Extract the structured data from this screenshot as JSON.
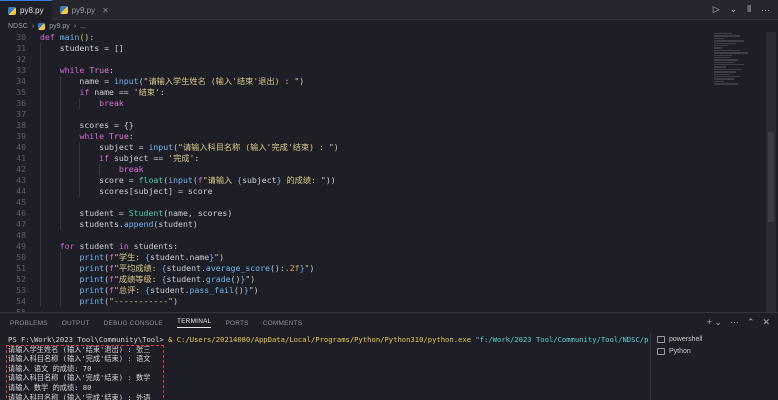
{
  "tabs": [
    {
      "label": "py8.py",
      "active": true,
      "closable": false
    },
    {
      "label": "py9.py",
      "active": false,
      "closable": true
    }
  ],
  "tabbar_actions": [
    "▷",
    "⌄",
    "⫴",
    "···"
  ],
  "breadcrumb": [
    "NDSC",
    "py9.py",
    "..."
  ],
  "code_lines": [
    {
      "n": "30",
      "html": "<span class=\"kw\">def</span> <span class=\"fn\">main</span><span class=\"br\">()</span>:",
      "indent": 0
    },
    {
      "n": "31",
      "html": "    students = []",
      "indent": 1
    },
    {
      "n": "32",
      "html": "",
      "indent": 1
    },
    {
      "n": "33",
      "html": "    <span class=\"kw\">while</span> <span class=\"kw2\">True</span>:",
      "indent": 1
    },
    {
      "n": "34",
      "html": "        name = <span class=\"fn\">input</span>(<span class=\"str\">\"请输入学生姓名 (输入'结束'退出) : \"</span>)",
      "indent": 2
    },
    {
      "n": "35",
      "html": "        <span class=\"kw\">if</span> name == <span class=\"str\">'结束'</span>:",
      "indent": 2
    },
    {
      "n": "36",
      "html": "            <span class=\"kw\">break</span>",
      "indent": 3
    },
    {
      "n": "37",
      "html": "",
      "indent": 2
    },
    {
      "n": "38",
      "html": "        scores = {}",
      "indent": 2
    },
    {
      "n": "39",
      "html": "        <span class=\"kw\">while</span> <span class=\"kw2\">True</span>:",
      "indent": 2
    },
    {
      "n": "40",
      "html": "            subject = <span class=\"fn\">input</span>(<span class=\"str\">\"请输入科目名称 (输入'完成'结束) : \"</span>)",
      "indent": 3
    },
    {
      "n": "41",
      "html": "            <span class=\"kw\">if</span> subject == <span class=\"str\">'完成'</span>:",
      "indent": 3
    },
    {
      "n": "42",
      "html": "                <span class=\"kw\">break</span>",
      "indent": 4
    },
    {
      "n": "43",
      "html": "            score = <span class=\"cls\">float</span>(<span class=\"fn\">input</span>(<span class=\"kw\">f</span><span class=\"str\">\"请输入 </span><span class=\"fn\">{</span>subject<span class=\"fn\">}</span><span class=\"str\"> 的成绩: \"</span>))",
      "indent": 3
    },
    {
      "n": "44",
      "html": "            scores[subject] = score",
      "indent": 3
    },
    {
      "n": "45",
      "html": "",
      "indent": 2
    },
    {
      "n": "46",
      "html": "        student = <span class=\"cls\">Student</span>(name, scores)",
      "indent": 2
    },
    {
      "n": "47",
      "html": "        students.<span class=\"fn\">append</span>(student)",
      "indent": 2
    },
    {
      "n": "48",
      "html": "",
      "indent": 1
    },
    {
      "n": "49",
      "html": "    <span class=\"kw\">for</span> student <span class=\"kw\">in</span> students:",
      "indent": 1
    },
    {
      "n": "50",
      "html": "        <span class=\"fn\">print</span>(<span class=\"kw\">f</span><span class=\"str\">\"学生: </span><span class=\"fn\">{</span>student.name<span class=\"fn\">}</span><span class=\"str\">\"</span>)",
      "indent": 2
    },
    {
      "n": "51",
      "html": "        <span class=\"fn\">print</span>(<span class=\"kw\">f</span><span class=\"str\">\"平均成绩: </span><span class=\"fn\">{</span>student.<span class=\"fn\">average_score</span>():<span class=\"num\">.2f</span><span class=\"fn\">}</span><span class=\"str\">\"</span>)",
      "indent": 2
    },
    {
      "n": "52",
      "html": "        <span class=\"fn\">print</span>(<span class=\"kw\">f</span><span class=\"str\">\"成绩等级: </span><span class=\"fn\">{</span>student.<span class=\"fn\">grade</span>()<span class=\"fn\">}</span><span class=\"str\">\"</span>)",
      "indent": 2
    },
    {
      "n": "53",
      "html": "        <span class=\"fn\">print</span>(<span class=\"kw\">f</span><span class=\"str\">\"总评: </span><span class=\"fn\">{</span>student.<span class=\"fn\">pass_fail</span>()<span class=\"fn\">}</span><span class=\"str\">\"</span>)",
      "indent": 2
    },
    {
      "n": "54",
      "html": "        <span class=\"fn\">print</span>(<span class=\"str\">\"-----------\"</span>)",
      "indent": 2
    },
    {
      "n": "55",
      "html": "",
      "indent": 0
    }
  ],
  "panel_tabs": [
    "PROBLEMS",
    "OUTPUT",
    "DEBUG CONSOLE",
    "TERMINAL",
    "PORTS",
    "COMMENTS"
  ],
  "active_panel_tab": "TERMINAL",
  "panel_actions": [
    "+ ⌄",
    "···",
    "⌃",
    "✕"
  ],
  "terminal": {
    "prompt": "PS F:\\Work\\2023 Tool\\Community\\Tool> ",
    "amp": "& ",
    "exe": "C:/Users/20214080/AppData/Local/Programs/Python/Python310/python.exe",
    "arg": " \"f:/Work/2023 Tool/Community/Tool/NDSC/py9.py\"",
    "output": [
      "请输入学生姓名 (输入'结束'退出) : 张三",
      "请输入科目名称 (输入'完成'结束) : 语文",
      "请输入 语文 的成绩: 70",
      "请输入科目名称 (输入'完成'结束) : 数学",
      "请输入 数学 的成绩: 80",
      "请输入科目名称 (输入'完成'结束) : 外语"
    ]
  },
  "terminal_list": [
    {
      "label": "powershell",
      "icon": "terminal-icon"
    },
    {
      "label": "Python",
      "icon": "terminal-icon"
    }
  ]
}
